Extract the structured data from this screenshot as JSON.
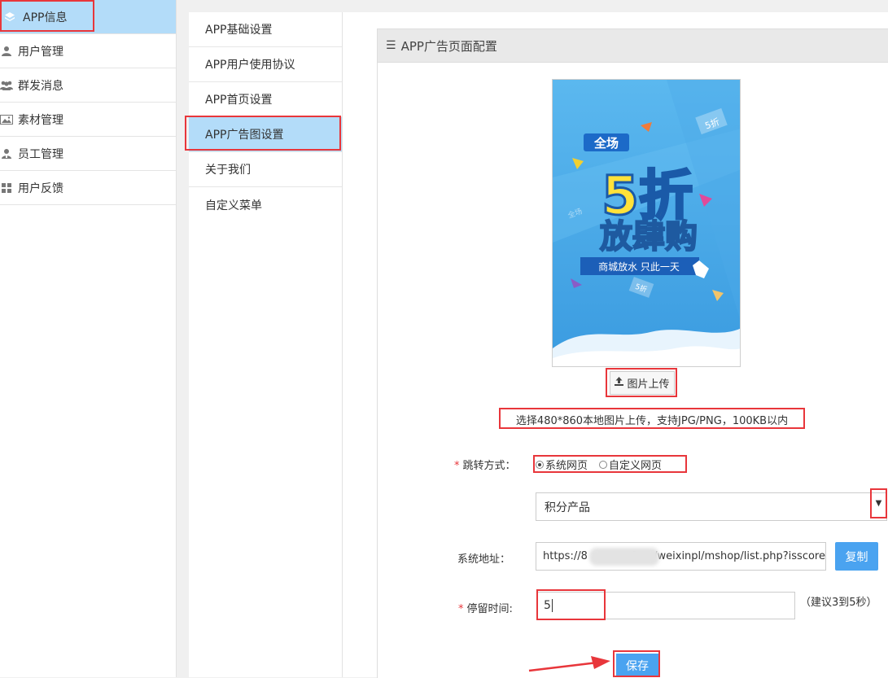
{
  "sidebar": {
    "items": [
      {
        "label": "APP信息",
        "icon": "stack-icon"
      },
      {
        "label": "用户管理",
        "icon": "user-icon"
      },
      {
        "label": "群发消息",
        "icon": "users-icon"
      },
      {
        "label": "素材管理",
        "icon": "image-icon"
      },
      {
        "label": "员工管理",
        "icon": "staff-icon"
      },
      {
        "label": "用户反馈",
        "icon": "grid-icon"
      }
    ]
  },
  "submenu": {
    "items": [
      {
        "label": "APP基础设置"
      },
      {
        "label": "APP用户使用协议"
      },
      {
        "label": "APP首页设置"
      },
      {
        "label": "APP广告图设置"
      },
      {
        "label": "关于我们"
      },
      {
        "label": "自定义菜单"
      }
    ]
  },
  "panel": {
    "title": "APP广告页面配置",
    "ad": {
      "tag": "全场",
      "big": "5折",
      "main": "放肆购",
      "ribbon": "商城放水 只此一天",
      "coupon": "5折",
      "coupon2": "全场"
    },
    "upload_label": "图片上传",
    "upload_hint": "选择480*860本地图片上传，支持JPG/PNG，100KB以内",
    "jump_label": "跳转方式：",
    "jump_options": [
      "系统网页",
      "自定义网页"
    ],
    "select_value": "积分产品",
    "url_label": "系统地址：",
    "url_prefix": "https://8",
    "url_suffix": "0.cn/weixinpl/mshop/list.php?isscore",
    "copy_label": "复制",
    "stay_label": "停留时间:",
    "stay_value": "5",
    "stay_hint": "（建议3到5秒）",
    "save_label": "保存"
  },
  "colors": {
    "accent": "#4aa3f0",
    "highlight": "#b3dcf9",
    "annotation": "#e8363b"
  }
}
